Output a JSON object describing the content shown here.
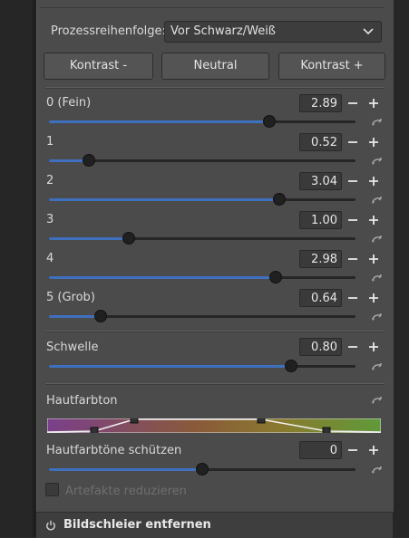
{
  "process_order": {
    "label": "Prozessreihenfolge:",
    "value": "Vor Schwarz/Weiß"
  },
  "buttons": [
    "Kontrast -",
    "Neutral",
    "Kontrast +"
  ],
  "sliders": [
    {
      "label": "0 (Fein)",
      "value": "2.89",
      "fraction": 0.72
    },
    {
      "label": "1",
      "value": "0.52",
      "fraction": 0.13
    },
    {
      "label": "2",
      "value": "3.04",
      "fraction": 0.75
    },
    {
      "label": "3",
      "value": "1.00",
      "fraction": 0.26
    },
    {
      "label": "4",
      "value": "2.98",
      "fraction": 0.74
    },
    {
      "label": "5 (Grob)",
      "value": "0.64",
      "fraction": 0.17
    }
  ],
  "threshold": {
    "label": "Schwelle",
    "value": "0.80",
    "fraction": 0.79
  },
  "skin_tone": {
    "label": "Hautfarbton",
    "colors": {
      "left": "#7a3f8a",
      "right": "#5f9a3a"
    }
  },
  "protect_skin": {
    "label": "Hautfarbtöne schützen",
    "value": "0",
    "fraction": 0.5
  },
  "artifacts": {
    "label": "Artefakte reduzieren",
    "checked": false
  },
  "footer": {
    "title": "Bildschleier entfernen"
  },
  "icons": {
    "reset": "reset-icon",
    "minus": "minus-icon",
    "plus": "plus-icon",
    "power": "power-icon",
    "dropdown": "chevron-down-icon"
  }
}
